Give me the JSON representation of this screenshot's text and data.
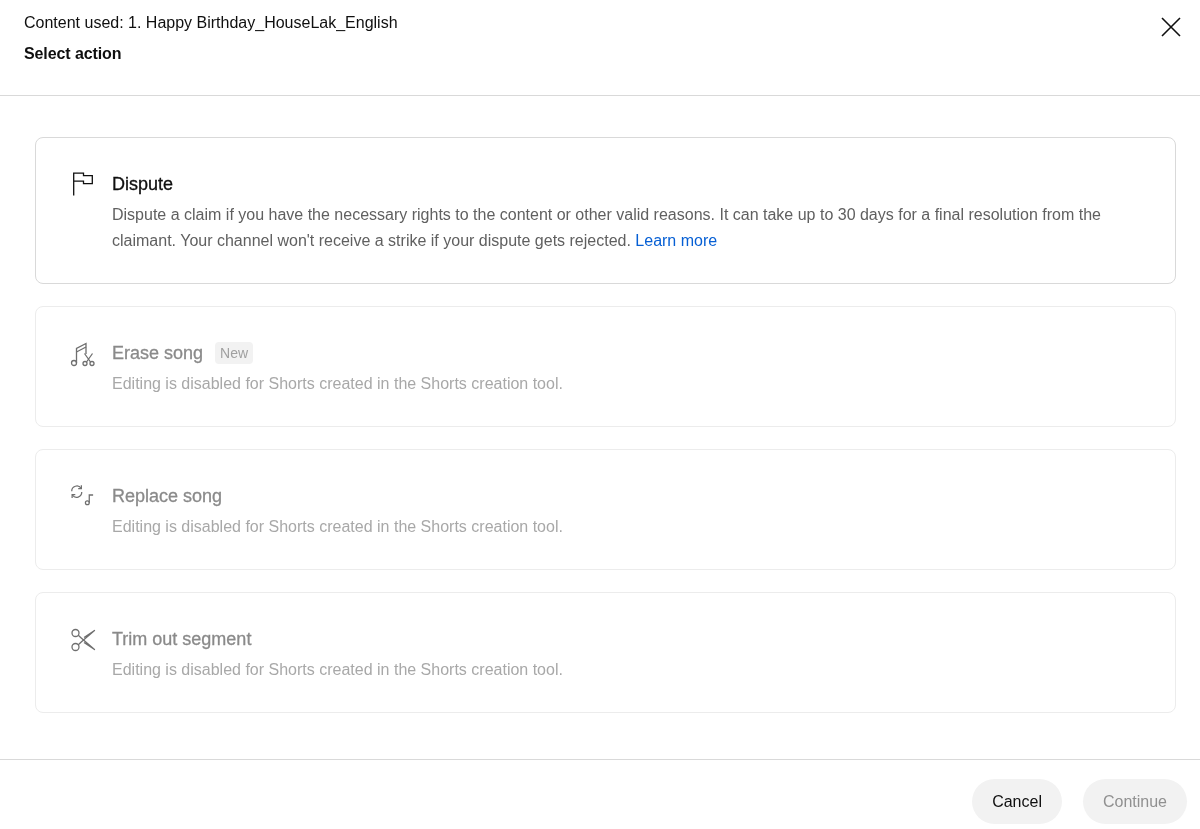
{
  "header": {
    "content_used": "Content used: 1. Happy Birthday_HouseLak_English",
    "title": "Select action"
  },
  "actions": [
    {
      "kind": "dispute",
      "title": "Dispute",
      "description": "Dispute a claim if you have the necessary rights to the content or other valid reasons. It can take up to 30 days for a final resolution from the claimant. Your channel won't receive a strike if your dispute gets rejected.",
      "link": "Learn more",
      "disabled": false
    },
    {
      "kind": "erase",
      "title": "Erase song",
      "badge": "New",
      "description": "Editing is disabled for Shorts created in the Shorts creation tool.",
      "disabled": true
    },
    {
      "kind": "replace",
      "title": "Replace song",
      "description": "Editing is disabled for Shorts created in the Shorts creation tool.",
      "disabled": true
    },
    {
      "kind": "trim",
      "title": "Trim out segment",
      "description": "Editing is disabled for Shorts created in the Shorts creation tool.",
      "disabled": true
    }
  ],
  "buttons": [
    {
      "label": "Cancel",
      "disabled": false
    },
    {
      "label": "Continue",
      "disabled": true
    }
  ]
}
